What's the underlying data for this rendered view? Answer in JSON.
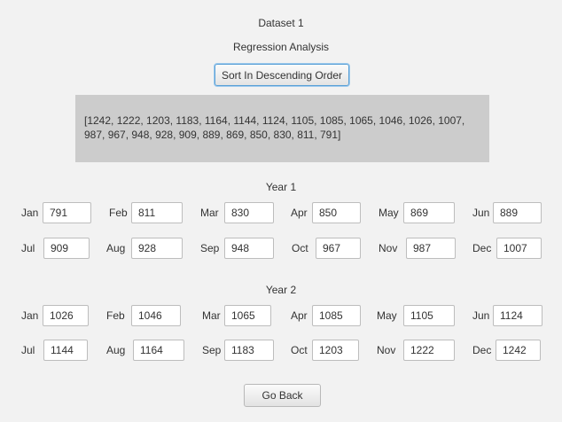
{
  "dataset_title": "Dataset 1",
  "analysis_title": "Regression Analysis",
  "sort_button": "Sort In Descending Order",
  "sorted_values_text": "[1242, 1222, 1203, 1183, 1164, 1144, 1124, 1105, 1085, 1065, 1046, 1026, 1007, 987, 967, 948, 928, 909, 889, 869, 850, 830, 811, 791]",
  "years": [
    {
      "label": "Year 1",
      "months": [
        {
          "label": "Jan",
          "value": "791"
        },
        {
          "label": "Feb",
          "value": "811"
        },
        {
          "label": "Mar",
          "value": "830"
        },
        {
          "label": "Apr",
          "value": "850"
        },
        {
          "label": "May",
          "value": "869"
        },
        {
          "label": "Jun",
          "value": "889"
        },
        {
          "label": "Jul",
          "value": "909"
        },
        {
          "label": "Aug",
          "value": "928"
        },
        {
          "label": "Sep",
          "value": "948"
        },
        {
          "label": "Oct",
          "value": "967"
        },
        {
          "label": "Nov",
          "value": "987"
        },
        {
          "label": "Dec",
          "value": "1007"
        }
      ]
    },
    {
      "label": "Year 2",
      "months": [
        {
          "label": "Jan",
          "value": "1026"
        },
        {
          "label": "Feb",
          "value": "1046"
        },
        {
          "label": "Mar",
          "value": "1065"
        },
        {
          "label": "Apr",
          "value": "1085"
        },
        {
          "label": "May",
          "value": "1105"
        },
        {
          "label": "Jun",
          "value": "1124"
        },
        {
          "label": "Jul",
          "value": "1144"
        },
        {
          "label": "Aug",
          "value": "1164"
        },
        {
          "label": "Sep",
          "value": "1183"
        },
        {
          "label": "Oct",
          "value": "1203"
        },
        {
          "label": "Nov",
          "value": "1222"
        },
        {
          "label": "Dec",
          "value": "1242"
        }
      ]
    }
  ],
  "back_button": "Go Back",
  "colors": {
    "background": "#f2f2f2",
    "text_area": "#cccccc",
    "focus_ring": "#5aa0d6"
  }
}
